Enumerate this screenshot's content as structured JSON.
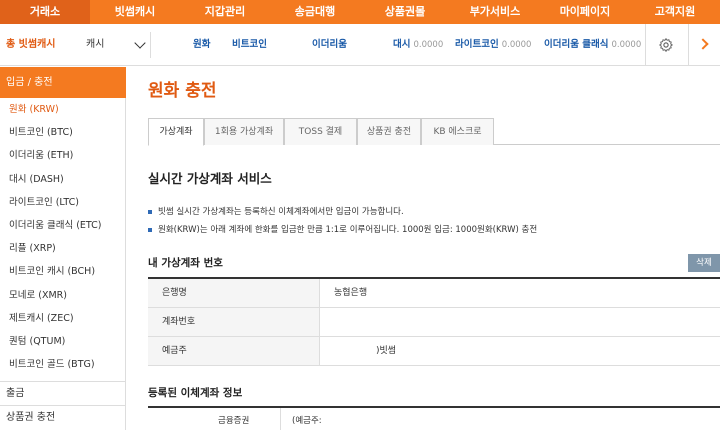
{
  "topnav": {
    "items": [
      "거래소",
      "빗썸캐시",
      "지갑관리",
      "송금대행",
      "상품권몰",
      "부가서비스",
      "마이페이지",
      "고객지원"
    ]
  },
  "ticker": {
    "total_label": "총 빗썸캐시",
    "currency_label": "캐시",
    "coins": [
      {
        "name": "원화",
        "price": ""
      },
      {
        "name": "비트코인",
        "price": ""
      },
      {
        "name": "이더리움",
        "price": ""
      },
      {
        "name": "대시",
        "price": "0.0000"
      },
      {
        "name": "라이트코인",
        "price": "0.0000"
      },
      {
        "name": "이더리움 클래식",
        "price": "0.0000"
      }
    ]
  },
  "sidebar": {
    "header": "입금 / 충전",
    "items": [
      "원화 (KRW)",
      "비트코인 (BTC)",
      "이더리움 (ETH)",
      "대시 (DASH)",
      "라이트코인 (LTC)",
      "이더리움 클래식 (ETC)",
      "리플 (XRP)",
      "비트코인 캐시 (BCH)",
      "모네로 (XMR)",
      "제트캐시 (ZEC)",
      "퀀텀 (QTUM)",
      "비트코인 골드 (BTG)"
    ],
    "groups": [
      "출금",
      "상품권 충전"
    ]
  },
  "main": {
    "title": "원화 충전",
    "tabs": [
      "가상계좌",
      "1회용 가상계좌",
      "TOSS 결제",
      "상품권 충전",
      "KB 에스크로"
    ],
    "section_title": "실시간 가상계좌 서비스",
    "info": [
      "빗썸 실시간 가상계좌는 등록하신 이체계좌에서만 입금이 가능합니다.",
      "원화(KRW)는 아래 계좌에 한화를 입금한 만큼 1:1로 이루어집니다. 1000원 입금: 1000원화(KRW) 충전"
    ],
    "account": {
      "title": "내 가상계좌 번호",
      "delete_label": "삭제",
      "rows": [
        {
          "key": "은행명",
          "value": "농협은행"
        },
        {
          "key": "계좌번호",
          "value": ""
        },
        {
          "key": "예금주",
          "value": ")빗썸"
        }
      ]
    },
    "registered": {
      "title": "등록된 이체계좌 정보",
      "col1": "금융증권",
      "col2": "(예금주:"
    }
  },
  "colors": {
    "accent": "#f47a20",
    "accent_dark": "#e05a12",
    "link_blue": "#1a5aa8"
  }
}
